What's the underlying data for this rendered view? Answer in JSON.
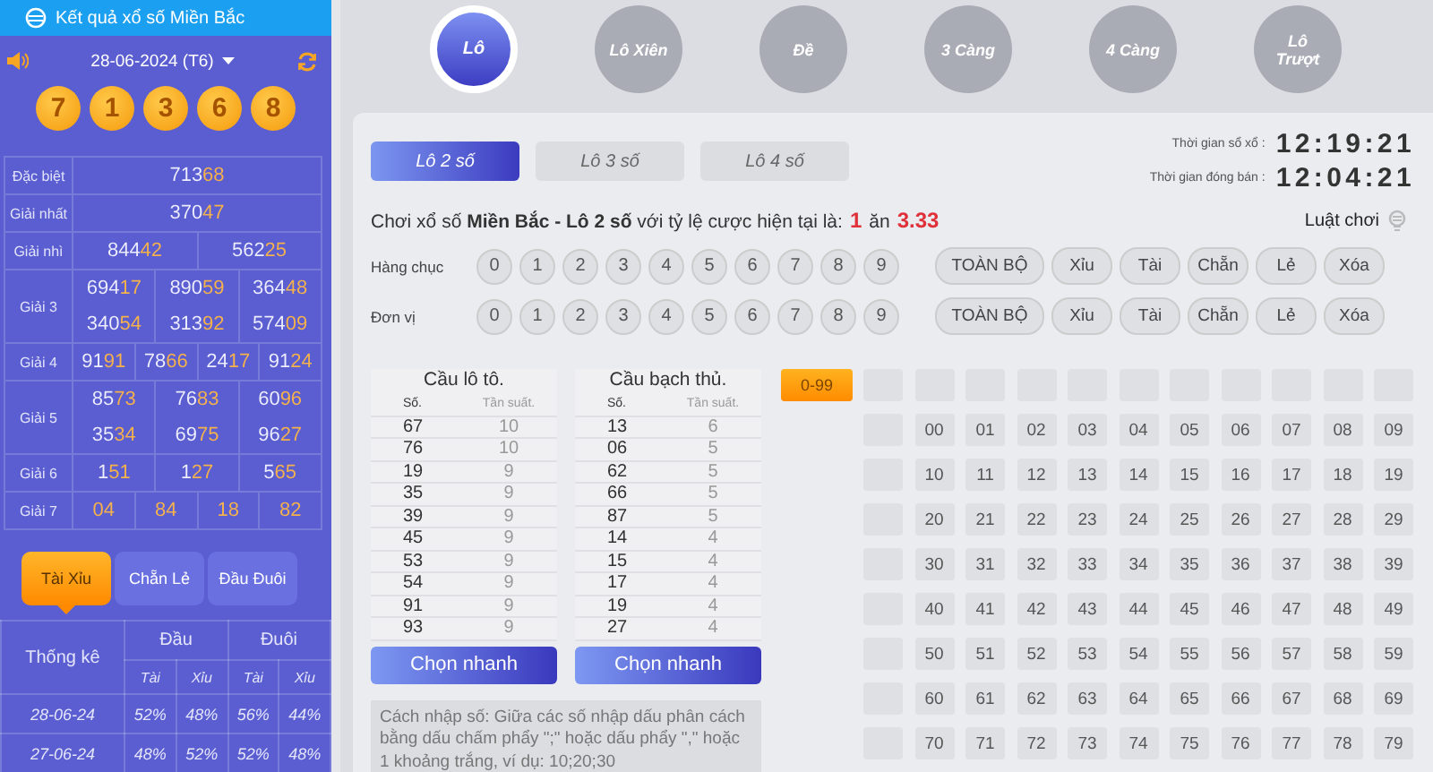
{
  "results_panel": {
    "title": "Kết quả xổ số Miền Bắc",
    "date": "28-06-2024 (T6)",
    "balls": [
      "7",
      "1",
      "3",
      "6",
      "8"
    ],
    "prizes": [
      {
        "name": "Đặc biệt",
        "rows": [
          [
            "71368"
          ]
        ]
      },
      {
        "name": "Giải nhất",
        "rows": [
          [
            "37047"
          ]
        ]
      },
      {
        "name": "Giải nhì",
        "rows": [
          [
            "84442",
            "56225"
          ]
        ]
      },
      {
        "name": "Giải 3",
        "rows": [
          [
            "69417",
            "89059",
            "36448"
          ],
          [
            "34054",
            "31392",
            "57409"
          ]
        ]
      },
      {
        "name": "Giải 4",
        "rows": [
          [
            "9191",
            "7866",
            "2417",
            "9124"
          ]
        ]
      },
      {
        "name": "Giải 5",
        "rows": [
          [
            "8573",
            "7683",
            "6096"
          ],
          [
            "3534",
            "6975",
            "9627"
          ]
        ]
      },
      {
        "name": "Giải 6",
        "rows": [
          [
            "151",
            "127",
            "565"
          ]
        ]
      },
      {
        "name": "Giải 7",
        "rows": [
          [
            "04",
            "84",
            "18",
            "82"
          ]
        ]
      }
    ],
    "tabs": [
      {
        "label": "Tài Xỉu",
        "selected": true
      },
      {
        "label": "Chẵn Lẻ",
        "selected": false
      },
      {
        "label": "Đầu Đuôi",
        "selected": false
      }
    ],
    "stats": {
      "title": "Thống kê",
      "groups": [
        "Đầu",
        "Đuôi"
      ],
      "subheads": [
        "Tài",
        "Xỉu",
        "Tài",
        "Xỉu"
      ],
      "rows": [
        {
          "date": "28-06-24",
          "values": [
            "52%",
            "48%",
            "56%",
            "44%"
          ]
        },
        {
          "date": "27-06-24",
          "values": [
            "48%",
            "52%",
            "52%",
            "48%"
          ]
        }
      ]
    }
  },
  "games": [
    {
      "label": "Lô",
      "selected": true
    },
    {
      "label": "Lô Xiên",
      "selected": false
    },
    {
      "label": "Đề",
      "selected": false
    },
    {
      "label": "3 Càng",
      "selected": false
    },
    {
      "label": "4 Càng",
      "selected": false
    },
    {
      "label": "Lô Trượt",
      "selected": false
    }
  ],
  "bet_types": [
    {
      "label": "Lô 2 số",
      "selected": true
    },
    {
      "label": "Lô 3 số",
      "selected": false
    },
    {
      "label": "Lô 4 số",
      "selected": false
    }
  ],
  "timers": [
    {
      "label": "Thời gian sổ xổ :",
      "value": "12:19:21"
    },
    {
      "label": "Thời gian đóng bán :",
      "value": "12:04:21"
    }
  ],
  "odds": {
    "text": "Chơi xổ số **Miền Bắc - Lô 2 số** với tỷ lệ cược hiện tại là:",
    "stake": "1",
    "word": "ăn",
    "payout": "3.33"
  },
  "rules_link": "Luật chơi",
  "digit_rows": [
    {
      "label": "Hàng chục",
      "digits": [
        "0",
        "1",
        "2",
        "3",
        "4",
        "5",
        "6",
        "7",
        "8",
        "9"
      ],
      "actions": [
        "TOÀN BỘ",
        "Xỉu",
        "Tài",
        "Chẵn",
        "Lẻ",
        "Xóa"
      ]
    },
    {
      "label": "Đơn vị",
      "digits": [
        "0",
        "1",
        "2",
        "3",
        "4",
        "5",
        "6",
        "7",
        "8",
        "9"
      ],
      "actions": [
        "TOÀN BỘ",
        "Xỉu",
        "Tài",
        "Chẵn",
        "Lẻ",
        "Xóa"
      ]
    }
  ],
  "stat_tables": [
    {
      "title": "Cầu lô tô.",
      "columns": [
        "Số.",
        "Tần suất."
      ],
      "rows": [
        [
          "67",
          "10"
        ],
        [
          "76",
          "10"
        ],
        [
          "19",
          "9"
        ],
        [
          "35",
          "9"
        ],
        [
          "39",
          "9"
        ],
        [
          "45",
          "9"
        ],
        [
          "53",
          "9"
        ],
        [
          "54",
          "9"
        ],
        [
          "91",
          "9"
        ],
        [
          "93",
          "9"
        ]
      ],
      "button": "Chọn nhanh"
    },
    {
      "title": "Cầu bạch thủ.",
      "columns": [
        "Số.",
        "Tần suất."
      ],
      "rows": [
        [
          "13",
          "6"
        ],
        [
          "06",
          "5"
        ],
        [
          "62",
          "5"
        ],
        [
          "66",
          "5"
        ],
        [
          "87",
          "5"
        ],
        [
          "14",
          "4"
        ],
        [
          "15",
          "4"
        ],
        [
          "17",
          "4"
        ],
        [
          "19",
          "4"
        ],
        [
          "27",
          "4"
        ]
      ],
      "button": "Chọn nhanh"
    }
  ],
  "hint": "Cách nhập số: Giữa các số nhập dấu phân cách bằng dấu chấm phẩy \";\" hoặc dấu phẩy \",\" hoặc 1 khoảng trắng, ví dụ: 10;20;30",
  "number_grid": {
    "range_button": "0-99",
    "rows": [
      [
        "00",
        "01",
        "02",
        "03",
        "04",
        "05",
        "06",
        "07",
        "08",
        "09"
      ],
      [
        "10",
        "11",
        "12",
        "13",
        "14",
        "15",
        "16",
        "17",
        "18",
        "19"
      ],
      [
        "20",
        "21",
        "22",
        "23",
        "24",
        "25",
        "26",
        "27",
        "28",
        "29"
      ],
      [
        "30",
        "31",
        "32",
        "33",
        "34",
        "35",
        "36",
        "37",
        "38",
        "39"
      ],
      [
        "40",
        "41",
        "42",
        "43",
        "44",
        "45",
        "46",
        "47",
        "48",
        "49"
      ],
      [
        "50",
        "51",
        "52",
        "53",
        "54",
        "55",
        "56",
        "57",
        "58",
        "59"
      ],
      [
        "60",
        "61",
        "62",
        "63",
        "64",
        "65",
        "66",
        "67",
        "68",
        "69"
      ],
      [
        "70",
        "71",
        "72",
        "73",
        "74",
        "75",
        "76",
        "77",
        "78",
        "79"
      ]
    ]
  }
}
